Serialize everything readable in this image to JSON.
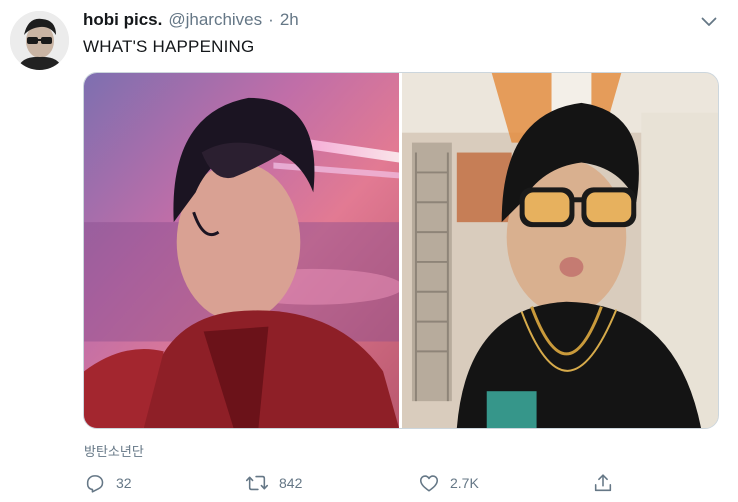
{
  "tweet": {
    "display_name": "hobi pics.",
    "handle": "@jharchives",
    "separator": "·",
    "time": "2h",
    "text": "WHAT'S HAPPENING",
    "translate_hint": "방탄소년단"
  },
  "actions": {
    "reply_count": "32",
    "retweet_count": "842",
    "like_count": "2.7K"
  },
  "icons": {
    "menu": "chevron-down-icon",
    "reply": "reply-icon",
    "retweet": "retweet-icon",
    "like": "heart-icon",
    "share": "share-icon"
  },
  "colors": {
    "text_primary": "#14171a",
    "text_secondary": "#657786",
    "border": "#ccd6dd"
  }
}
